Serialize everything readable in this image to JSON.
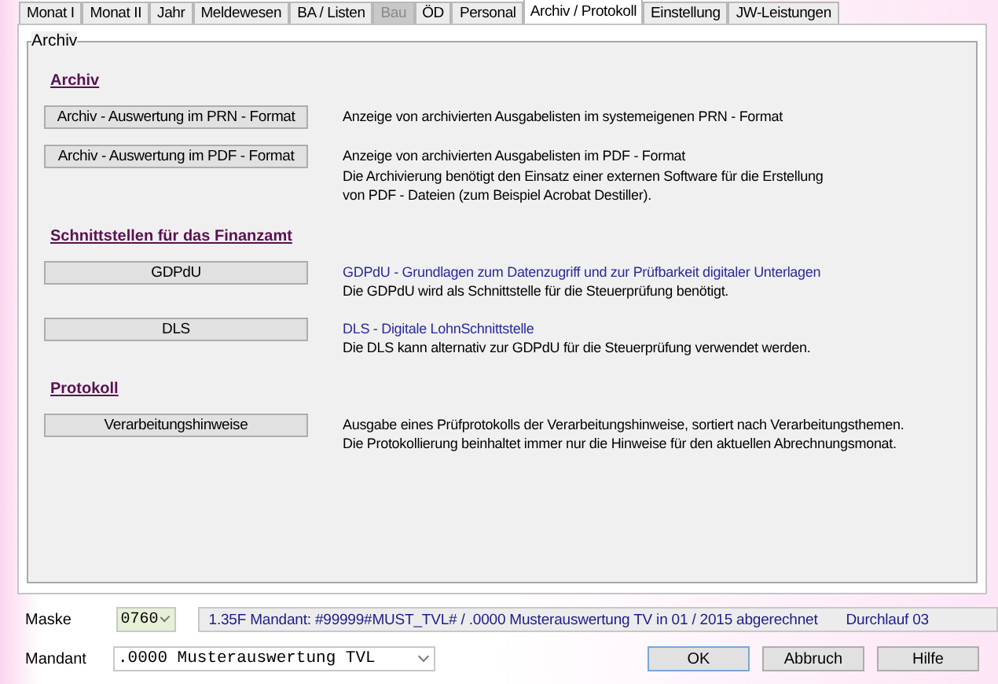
{
  "tabs": [
    {
      "label": "Monat I",
      "selected": false,
      "disabled": false
    },
    {
      "label": "Monat II",
      "selected": false,
      "disabled": false
    },
    {
      "label": "Jahr",
      "selected": false,
      "disabled": false
    },
    {
      "label": "Meldewesen",
      "selected": false,
      "disabled": false
    },
    {
      "label": "BA / Listen",
      "selected": false,
      "disabled": false
    },
    {
      "label": "Bau",
      "selected": false,
      "disabled": true
    },
    {
      "label": "ÖD",
      "selected": false,
      "disabled": false
    },
    {
      "label": "Personal",
      "selected": false,
      "disabled": false
    },
    {
      "label": "Archiv / Protokoll",
      "selected": true,
      "disabled": false
    },
    {
      "label": "Einstellung",
      "selected": false,
      "disabled": false
    },
    {
      "label": "JW-Leistungen",
      "selected": false,
      "disabled": false
    }
  ],
  "group": {
    "title": "Archiv",
    "sections": [
      {
        "heading": "Archiv",
        "items": [
          {
            "button": "Archiv - Auswertung im PRN - Format",
            "lines": [
              {
                "kind": "text",
                "text": "Anzeige von archivierten Ausgabelisten im systemeigenen PRN - Format"
              }
            ]
          },
          {
            "button": "Archiv - Auswertung im PDF - Format",
            "lines": [
              {
                "kind": "text",
                "text": "Anzeige von archivierten Ausgabelisten im PDF - Format"
              },
              {
                "kind": "text",
                "text": "Die Archivierung benötigt den Einsatz einer externen Software für die Erstellung"
              },
              {
                "kind": "text",
                "text": "von PDF - Dateien (zum Beispiel Acrobat Destiller)."
              }
            ]
          }
        ]
      },
      {
        "heading": "Schnittstellen für das Finanzamt",
        "items": [
          {
            "button": "GDPdU",
            "lines": [
              {
                "kind": "title",
                "text": "GDPdU - Grundlagen zum Datenzugriff und zur Prüfbarkeit digitaler Unterlagen"
              },
              {
                "kind": "text",
                "text": "Die GDPdU wird als Schnittstelle für die Steuerprüfung benötigt."
              }
            ]
          },
          {
            "button": "DLS",
            "lines": [
              {
                "kind": "title",
                "text": "DLS - Digitale LohnSchnittstelle"
              },
              {
                "kind": "text",
                "text": "Die DLS kann alternativ zur GDPdU für die Steuerprüfung verwendet werden."
              }
            ]
          }
        ]
      },
      {
        "heading": "Protokoll",
        "items": [
          {
            "button": "Verarbeitungshinweise",
            "lines": [
              {
                "kind": "text",
                "text": "Ausgabe eines Prüfprotokolls der Verarbeitungshinweise, sortiert nach Verarbeitungsthemen."
              },
              {
                "kind": "text",
                "text": "Die Protokollierung beinhaltet immer nur die Hinweise für den aktuellen Abrechnungsmonat."
              }
            ]
          }
        ]
      }
    ]
  },
  "maske": {
    "label": "Maske",
    "value": "0760",
    "status": "1.35F Mandant: #99999#MUST_TVL# / .0000 Musterauswertung TV in 01 / 2015 abgerechnet",
    "run": "Durchlauf 03"
  },
  "mandant": {
    "label": "Mandant",
    "value": ".0000 Musterauswertung TVL"
  },
  "buttons": [
    "OK",
    "Abbruch",
    "Hilfe"
  ]
}
